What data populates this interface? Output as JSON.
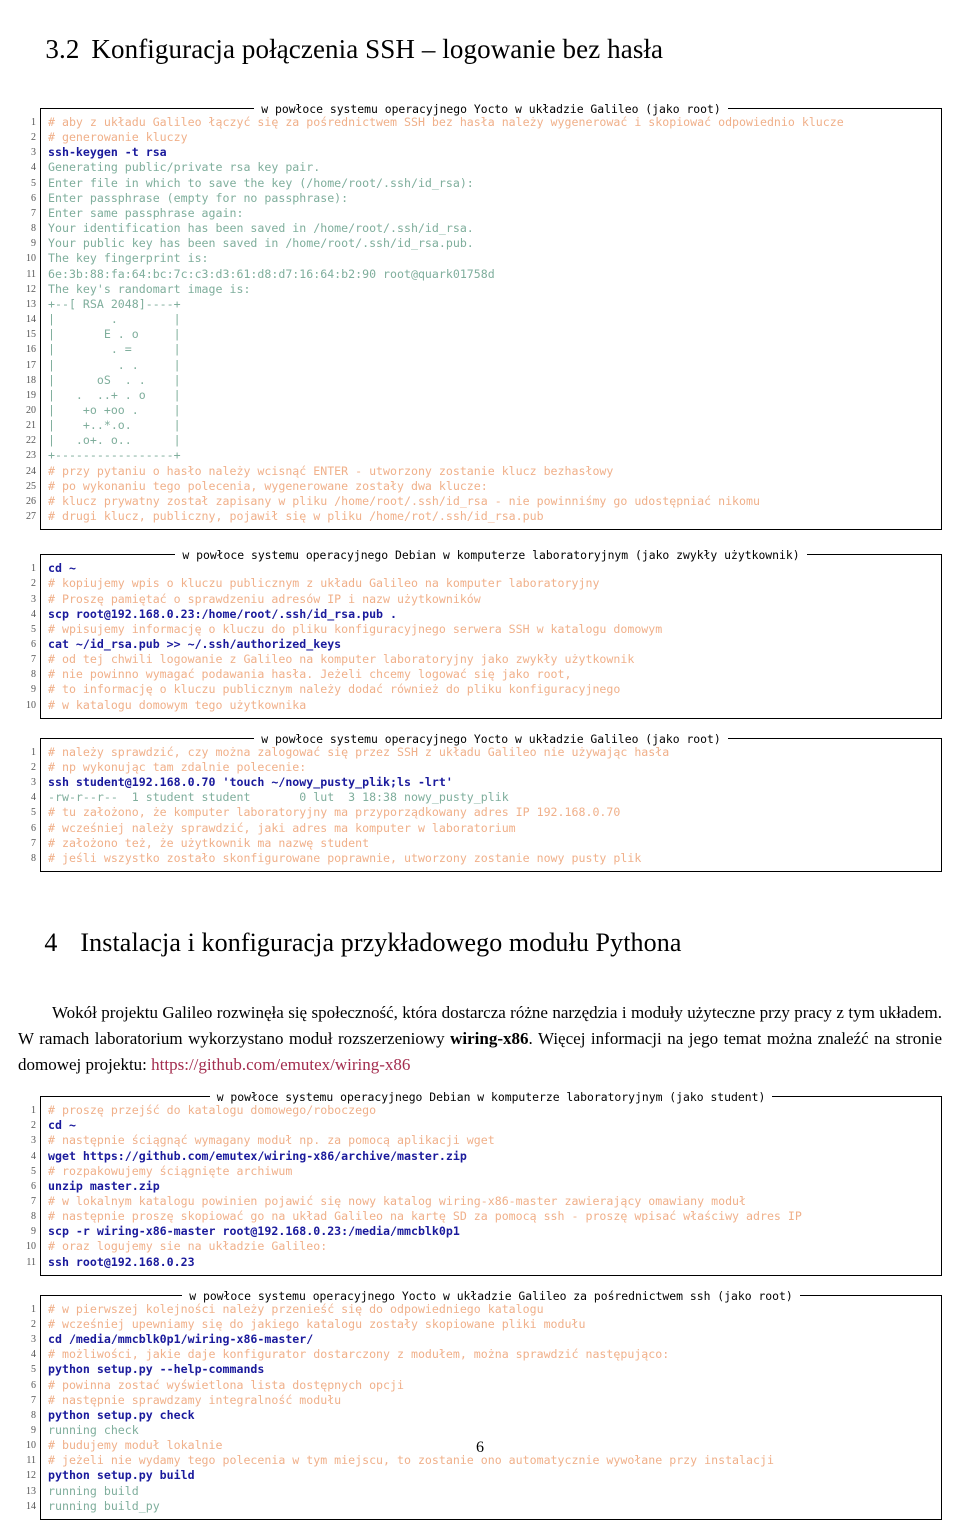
{
  "document": {
    "page_number": "6"
  },
  "sections": {
    "s32": {
      "number": "3.2",
      "title": "Konfiguracja połączenia SSH – logowanie bez hasła"
    },
    "s4": {
      "number": "4",
      "title": "Instalacja i konfiguracja przykładowego modułu Pythona"
    }
  },
  "paragraph": {
    "part1": "Wokół projektu Galileo rozwinęła się społeczność, która dostarcza różne narzędzia i moduły użyteczne przy pracy z tym układem. W ramach laboratorium wykorzystano moduł rozszerzeniowy ",
    "bold1": "wiring-x86",
    "part2": ". Więcej informacji na jego temat można znaleźć na stronie domowej projektu: ",
    "url": "https://github.com/emutex/wiring-x86"
  },
  "listings": [
    {
      "id": "listing-1",
      "caption": "w powłoce systemu operacyjnego Yocto w układzie Galileo (jako root)",
      "lines": [
        {
          "n": "1",
          "t": "cmt",
          "text": "# aby z układu Galileo łączyć się za pośrednictwem SSH bez hasła należy wygenerować i skopiować odpowiednio klucze"
        },
        {
          "n": "2",
          "t": "cmt",
          "text": "# generowanie kluczy"
        },
        {
          "n": "3",
          "t": "cmd",
          "text": "ssh-keygen -t rsa"
        },
        {
          "n": "4",
          "t": "out",
          "text": "Generating public/private rsa key pair."
        },
        {
          "n": "5",
          "t": "out",
          "text": "Enter file in which to save the key (/home/root/.ssh/id_rsa):"
        },
        {
          "n": "6",
          "t": "out",
          "text": "Enter passphrase (empty for no passphrase):"
        },
        {
          "n": "7",
          "t": "out",
          "text": "Enter same passphrase again:"
        },
        {
          "n": "8",
          "t": "out",
          "text": "Your identification has been saved in /home/root/.ssh/id_rsa."
        },
        {
          "n": "9",
          "t": "out",
          "text": "Your public key has been saved in /home/root/.ssh/id_rsa.pub."
        },
        {
          "n": "10",
          "t": "out",
          "text": "The key fingerprint is:"
        },
        {
          "n": "11",
          "t": "out",
          "text": "6e:3b:88:fa:64:bc:7c:c3:d3:61:d8:d7:16:64:b2:90 root@quark01758d"
        },
        {
          "n": "12",
          "t": "out",
          "text": "The key's randomart image is:"
        },
        {
          "n": "13",
          "t": "out",
          "text": "+--[ RSA 2048]----+"
        },
        {
          "n": "14",
          "t": "out",
          "text": "|        .        |"
        },
        {
          "n": "15",
          "t": "out",
          "text": "|       E . o     |"
        },
        {
          "n": "16",
          "t": "out",
          "text": "|        . =      |"
        },
        {
          "n": "17",
          "t": "out",
          "text": "|         . .     |"
        },
        {
          "n": "18",
          "t": "out",
          "text": "|      oS  . .    |"
        },
        {
          "n": "19",
          "t": "out",
          "text": "|   .  ..+ . o    |"
        },
        {
          "n": "20",
          "t": "out",
          "text": "|    +o +oo .     |"
        },
        {
          "n": "21",
          "t": "out",
          "text": "|    +..*.o.      |"
        },
        {
          "n": "22",
          "t": "out",
          "text": "|   .o+. o..      |"
        },
        {
          "n": "23",
          "t": "out",
          "text": "+-----------------+"
        },
        {
          "n": "24",
          "t": "cmt",
          "text": "# przy pytaniu o hasło należy wcisnąć ENTER - utworzony zostanie klucz bezhasłowy"
        },
        {
          "n": "25",
          "t": "cmt",
          "text": "# po wykonaniu tego polecenia, wygenerowane zostały dwa klucze:"
        },
        {
          "n": "26",
          "t": "cmt",
          "text": "# klucz prywatny został zapisany w pliku /home/root/.ssh/id_rsa - nie powinniśmy go udostępniać nikomu"
        },
        {
          "n": "27",
          "t": "cmt",
          "text": "# drugi klucz, publiczny, pojawił się w pliku /home/rot/.ssh/id_rsa.pub"
        }
      ]
    },
    {
      "id": "listing-2",
      "caption": "w powłoce systemu operacyjnego Debian w komputerze laboratoryjnym (jako zwykły użytkownik)",
      "lines": [
        {
          "n": "1",
          "t": "cmd",
          "text": "cd ~"
        },
        {
          "n": "2",
          "t": "cmt",
          "text": "# kopiujemy wpis o kluczu publicznym z układu Galileo na komputer laboratoryjny"
        },
        {
          "n": "3",
          "t": "cmt",
          "text": "# Proszę pamiętać o sprawdzeniu adresów IP i nazw użytkowników"
        },
        {
          "n": "4",
          "t": "cmd",
          "text": "scp root@192.168.0.23:/home/root/.ssh/id_rsa.pub ."
        },
        {
          "n": "5",
          "t": "cmt",
          "text": "# wpisujemy informację o kluczu do pliku konfiguracyjnego serwera SSH w katalogu domowym"
        },
        {
          "n": "6",
          "t": "cmd",
          "text": "cat ~/id_rsa.pub >> ~/.ssh/authorized_keys"
        },
        {
          "n": "7",
          "t": "cmt",
          "text": "# od tej chwili logowanie z Galileo na komputer laboratoryjny jako zwykły użytkownik"
        },
        {
          "n": "8",
          "t": "cmt",
          "text": "# nie powinno wymagać podawania hasła. Jeżeli chcemy logować się jako root,"
        },
        {
          "n": "9",
          "t": "cmt",
          "text": "# to informację o kluczu publicznym należy dodać również do pliku konfiguracyjnego"
        },
        {
          "n": "10",
          "t": "cmt",
          "text": "# w katalogu domowym tego użytkownika"
        }
      ]
    },
    {
      "id": "listing-3",
      "caption": "w powłoce systemu operacyjnego Yocto w układzie Galileo (jako root)",
      "lines": [
        {
          "n": "1",
          "t": "cmt",
          "text": "# należy sprawdzić, czy można zalogować się przez SSH z układu Galileo nie używając hasła"
        },
        {
          "n": "2",
          "t": "cmt",
          "text": "# np wykonując tam zdalnie polecenie:"
        },
        {
          "n": "3",
          "t": "cmd",
          "text": "ssh student@192.168.0.70 'touch ~/nowy_pusty_plik;ls -lrt'"
        },
        {
          "n": "4",
          "t": "out",
          "text": "-rw-r--r--  1 student student       0 lut  3 18:38 nowy_pusty_plik"
        },
        {
          "n": "5",
          "t": "cmt",
          "text": "# tu założono, że komputer laboratoryjny ma przyporządkowany adres IP 192.168.0.70"
        },
        {
          "n": "6",
          "t": "cmt",
          "text": "# wcześniej należy sprawdzić, jaki adres ma komputer w laboratorium"
        },
        {
          "n": "7",
          "t": "cmt",
          "text": "# założono też, że użytkownik ma nazwę student"
        },
        {
          "n": "8",
          "t": "cmt",
          "text": "# jeśli wszystko zostało skonfigurowane poprawnie, utworzony zostanie nowy pusty plik"
        }
      ]
    },
    {
      "id": "listing-4",
      "caption": "w powłoce systemu operacyjnego Debian w komputerze laboratoryjnym (jako student)",
      "lines": [
        {
          "n": "1",
          "t": "cmt",
          "text": "# proszę przejść do katalogu domowego/roboczego"
        },
        {
          "n": "2",
          "t": "cmd",
          "text": "cd ~"
        },
        {
          "n": "3",
          "t": "cmt",
          "text": "# następnie ściągnąć wymagany moduł np. za pomocą aplikacji wget"
        },
        {
          "n": "4",
          "t": "cmd",
          "text": "wget https://github.com/emutex/wiring-x86/archive/master.zip"
        },
        {
          "n": "5",
          "t": "cmt",
          "text": "# rozpakowujemy ściągnięte archiwum"
        },
        {
          "n": "6",
          "t": "cmd",
          "text": "unzip master.zip"
        },
        {
          "n": "7",
          "t": "cmt",
          "text": "# w lokalnym katalogu powinien pojawić się nowy katalog wiring-x86-master zawierający omawiany moduł"
        },
        {
          "n": "8",
          "t": "cmt",
          "text": "# następnie proszę skopiować go na układ Galileo na kartę SD za pomocą ssh - proszę wpisać właściwy adres IP"
        },
        {
          "n": "9",
          "t": "cmd",
          "text": "scp -r wiring-x86-master root@192.168.0.23:/media/mmcblk0p1"
        },
        {
          "n": "10",
          "t": "cmt",
          "text": "# oraz logujemy sie na układzie Galileo:"
        },
        {
          "n": "11",
          "t": "cmd",
          "text": "ssh root@192.168.0.23"
        }
      ]
    },
    {
      "id": "listing-5",
      "caption": "w powłoce systemu operacyjnego Yocto w układzie Galileo za pośrednictwem ssh (jako root)",
      "lines": [
        {
          "n": "1",
          "t": "cmt",
          "text": "# w pierwszej kolejności należy przenieść się do odpowiedniego katalogu"
        },
        {
          "n": "2",
          "t": "cmt",
          "text": "# wcześniej upewniamy się do jakiego katalogu zostały skopiowane pliki modułu"
        },
        {
          "n": "3",
          "t": "cmd",
          "text": "cd /media/mmcblk0p1/wiring-x86-master/"
        },
        {
          "n": "4",
          "t": "cmt",
          "text": "# możliwości, jakie daje konfigurator dostarczony z modułem, można sprawdzić następująco:"
        },
        {
          "n": "5",
          "t": "cmd",
          "text": "python setup.py --help-commands"
        },
        {
          "n": "6",
          "t": "cmt",
          "text": "# powinna zostać wyświetlona lista dostępnych opcji"
        },
        {
          "n": "7",
          "t": "cmt",
          "text": "# następnie sprawdzamy integralność modułu"
        },
        {
          "n": "8",
          "t": "cmd",
          "text": "python setup.py check"
        },
        {
          "n": "9",
          "t": "out",
          "text": "running check"
        },
        {
          "n": "10",
          "t": "cmt",
          "text": "# budujemy moduł lokalnie"
        },
        {
          "n": "11",
          "t": "cmt",
          "text": "# jeżeli nie wydamy tego polecenia w tym miejscu, to zostanie ono automatycznie wywołane przy instalacji"
        },
        {
          "n": "12",
          "t": "cmd",
          "text": "python setup.py build"
        },
        {
          "n": "13",
          "t": "out",
          "text": "running build"
        },
        {
          "n": "14",
          "t": "out",
          "text": "running build_py"
        }
      ]
    }
  ],
  "colors": {
    "comment": "#f0b08a",
    "command": "#1a1a9c",
    "output": "#7fae9c",
    "link": "#a32c4e",
    "frame": "#000000"
  }
}
